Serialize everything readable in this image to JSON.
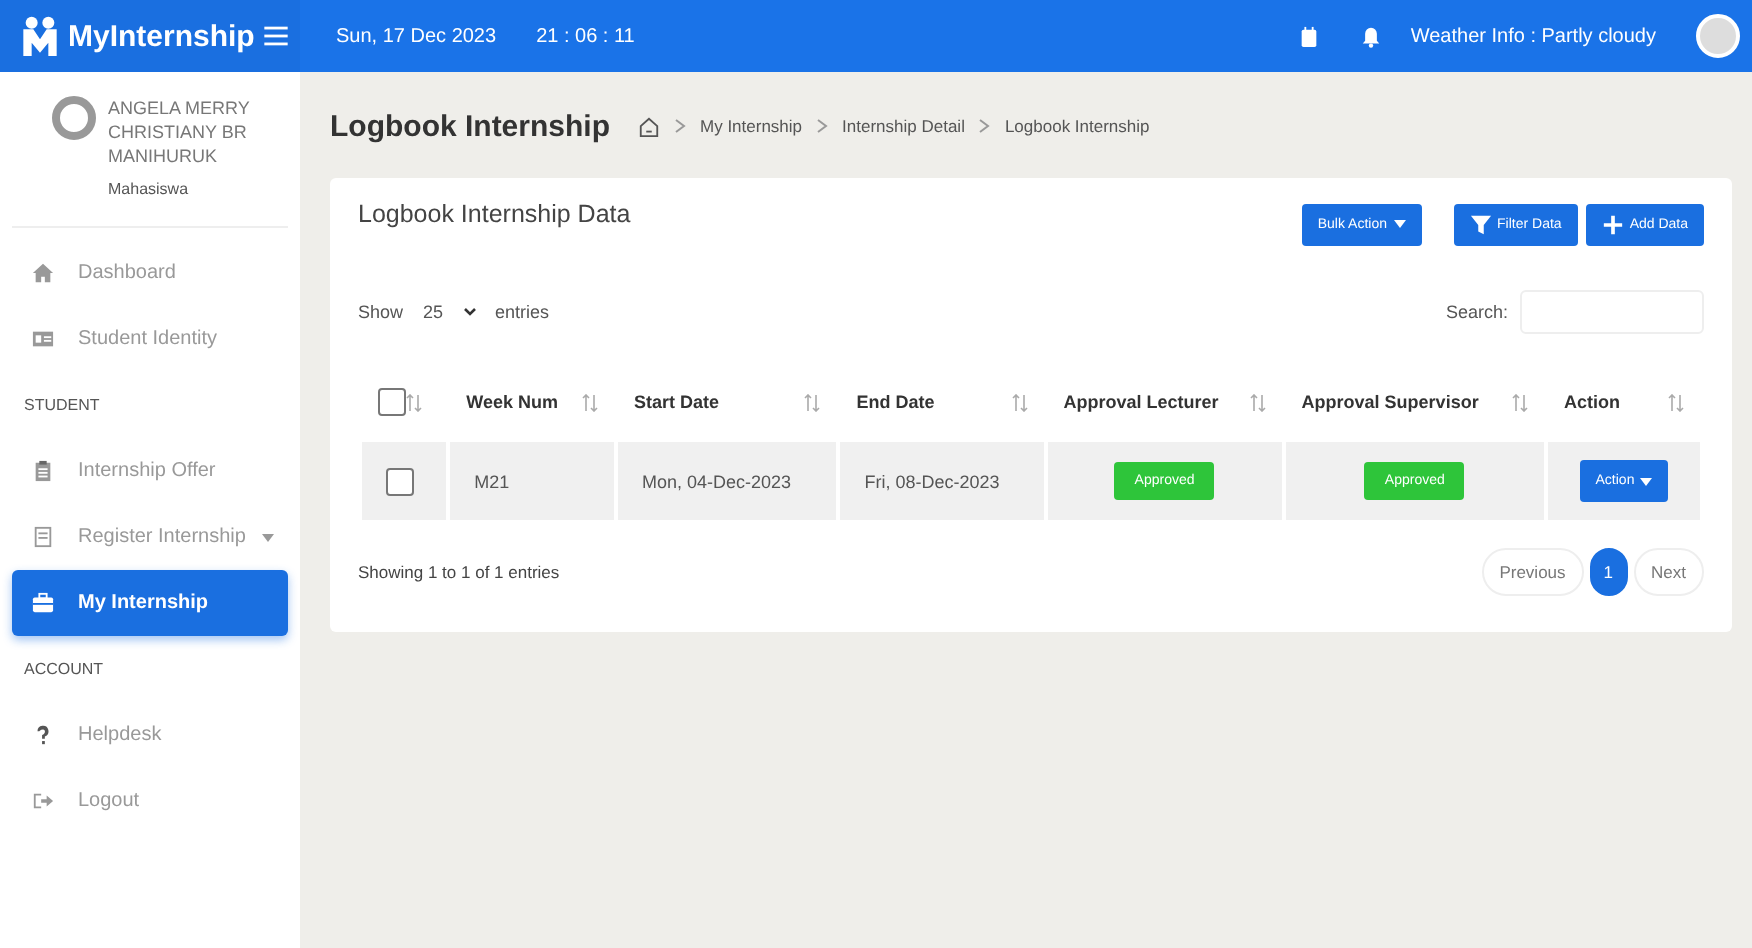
{
  "topbar": {
    "brand": "MyInternship",
    "date": "Sun, 17 Dec 2023",
    "time": "21 : 06 : 11",
    "weather": "Weather Info : Partly cloudy"
  },
  "sidebar": {
    "user": {
      "name": "ANGELA MERRY CHRISTIANY BR MANIHURUK",
      "role": "Mahasiswa"
    },
    "items": [
      {
        "kind": "link",
        "label": "Dashboard",
        "selected": false
      },
      {
        "kind": "link",
        "label": "Student Identity",
        "selected": false
      },
      {
        "kind": "heading",
        "label": "STUDENT"
      },
      {
        "kind": "link",
        "label": "Internship Offer",
        "selected": false
      },
      {
        "kind": "dropdown",
        "label": "Register Internship",
        "selected": false
      },
      {
        "kind": "link",
        "label": "My Internship",
        "selected": true
      },
      {
        "kind": "heading",
        "label": "ACCOUNT"
      },
      {
        "kind": "link",
        "label": "Helpdesk",
        "selected": false
      },
      {
        "kind": "link",
        "label": "Logout",
        "selected": false
      }
    ]
  },
  "page": {
    "title": "Logbook Internship",
    "breadcrumb": [
      "My Internship",
      "Internship Detail",
      "Logbook Internship"
    ]
  },
  "card": {
    "title": "Logbook Internship Data",
    "buttons": [
      {
        "kind": "dropdown",
        "label": "Bulk Action"
      },
      {
        "kind": "filter",
        "label": "Filter Data"
      },
      {
        "kind": "add",
        "label": "Add Data"
      }
    ],
    "length": {
      "before": "Show",
      "value": "25",
      "after": "entries"
    },
    "search_label": "Search:",
    "table": {
      "select_all": {
        "checked": false
      },
      "columns": [
        "Week Num",
        "Start Date",
        "End Date",
        "Approval Lecturer",
        "Approval Supervisor",
        "Action"
      ],
      "rows": [
        {
          "checked": false,
          "week": "M21",
          "start": "Mon, 04-Dec-2023",
          "end": "Fri, 08-Dec-2023",
          "lecturer": "Approved",
          "supervisor": "Approved",
          "action": "Action"
        }
      ]
    },
    "info": "Showing 1 to 1 of 1 entries",
    "pagination": [
      {
        "label": "Previous",
        "selected": false
      },
      {
        "label": "1",
        "selected": true
      },
      {
        "label": "Next",
        "selected": false
      }
    ]
  }
}
